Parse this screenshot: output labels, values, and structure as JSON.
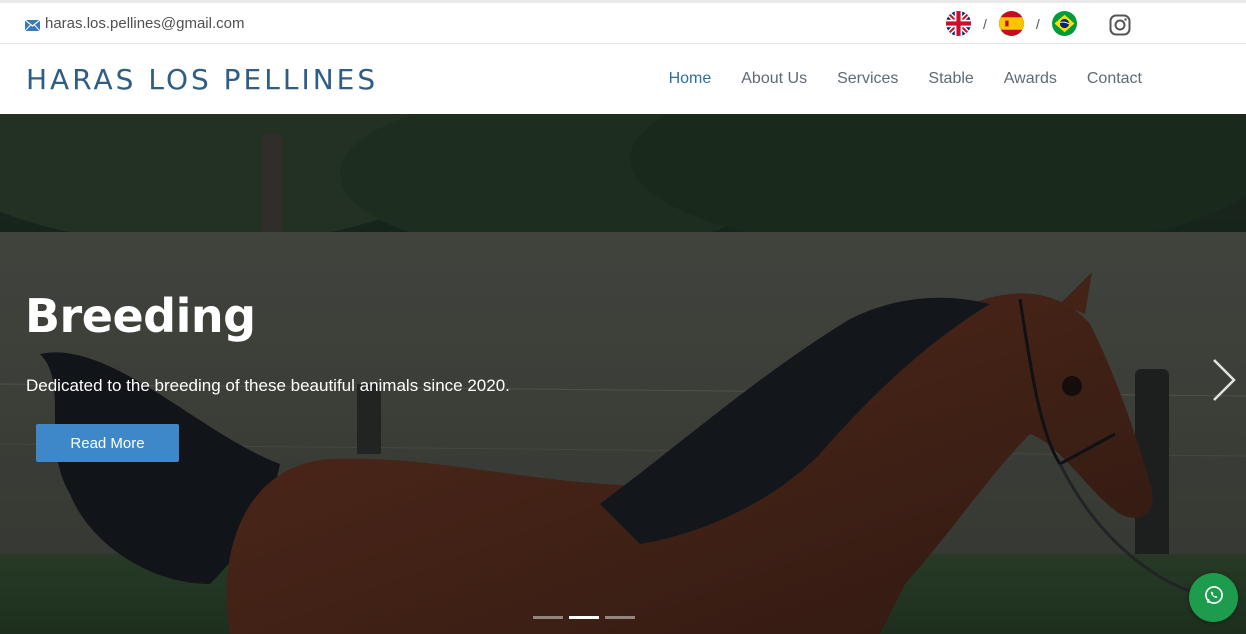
{
  "topbar": {
    "email": "haras.los.pellines@gmail.com",
    "email_icon": "envelope-icon",
    "separator": "/",
    "languages": [
      {
        "code": "en",
        "icon": "uk-flag-icon"
      },
      {
        "code": "es",
        "icon": "spain-flag-icon"
      },
      {
        "code": "pt",
        "icon": "brazil-flag-icon"
      }
    ],
    "social_icon": "instagram-icon"
  },
  "header": {
    "brand": "HARAS LOS PELLINES",
    "nav": [
      "Home",
      "About Us",
      "Services",
      "Stable",
      "Awards",
      "Contact"
    ],
    "active_nav": "Home"
  },
  "hero": {
    "title": "Breeding",
    "subtitle": "Dedicated to the breeding of these beautiful animals since 2020.",
    "button_label": "Read More",
    "next_icon": "chevron-right-icon",
    "slide_count": 3,
    "active_slide": 2
  },
  "floating": {
    "icon": "whatsapp-icon"
  },
  "colors": {
    "brand": "#2e5d85",
    "nav_active": "#2e6f9e",
    "button": "#3e87c9",
    "whatsapp": "#1e9c4e"
  }
}
